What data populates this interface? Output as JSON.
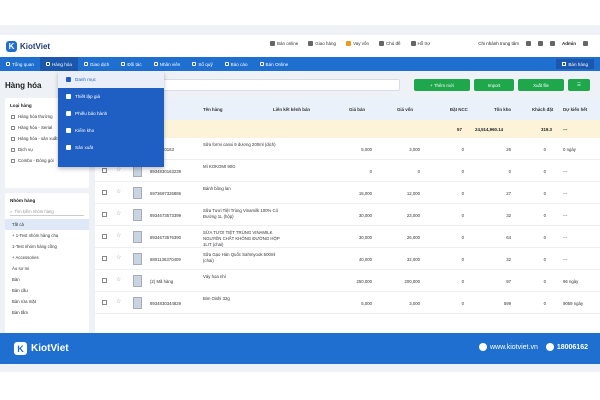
{
  "brand": {
    "name": "KiotViet",
    "letter": "K"
  },
  "toplinks": [
    "Bán online",
    "Giao hàng",
    "Vay vốn",
    "Chủ đề",
    "Hỗ trợ"
  ],
  "topright": {
    "branch": "Chi nhánh trung tâm",
    "user": "Admin"
  },
  "nav": {
    "items": [
      "Tổng quan",
      "Hàng hóa",
      "Giao dịch",
      "Đối tác",
      "Nhân viên",
      "Sổ quỹ",
      "Báo cáo",
      "Bán Online"
    ],
    "right": "Bán hàng"
  },
  "dropdown": [
    "Danh mục",
    "Thiết lập giá",
    "Phiếu bảo hành",
    "Kiểm kho",
    "Sản xuất"
  ],
  "page": {
    "title": "Hàng hóa",
    "btn_add": "+ Thêm mới",
    "btn_import": "Import",
    "btn_export": "Xuất file"
  },
  "left_type": {
    "title": "Loại hàng",
    "items": [
      "Hàng hóa thường",
      "Hàng hóa - Serial",
      "Hàng hóa - sản xuất",
      "Dịch vụ",
      "Combo - Đóng gói"
    ]
  },
  "left_group": {
    "title": "Nhóm hàng",
    "search_placeholder": "Tìm kiếm nhóm hàng",
    "items": [
      "Tất cả",
      "+ 1-Test nhóm hàng cha",
      "1-Test nhóm hàng cồng",
      "+ Accessories",
      "Áo sơ mi",
      "Bàn",
      "Bàn cầu",
      "Bàn rửa mặt",
      "Bàn tắm"
    ]
  },
  "table": {
    "headers": [
      "Mã hàng",
      "Tên hàng",
      "Liên kết kênh bán",
      "Giá bán",
      "Giá vốn",
      "Đặt NCC",
      "Tồn kho",
      "Khách đặt",
      "Dự kiến hết"
    ],
    "summary": {
      "dat_ncc": "57",
      "ton_kho": "24,514,960.14",
      "khach_dat": "319.3",
      "du_kien": "---"
    },
    "rows": [
      {
        "code": "8934830163",
        "name": "Sữa formi canxi 9 dương 200ml (dịch)",
        "price": "5,000",
        "cost": "3,000",
        "ncc": "0",
        "stock": "26",
        "order": "0",
        "eta": "0 ngày"
      },
      {
        "code": "8934830163239",
        "name": "Mì KOKOMI 90G",
        "price": "0",
        "cost": "0",
        "ncc": "0",
        "stock": "0",
        "order": "0",
        "eta": "---"
      },
      {
        "code": "6973697326886",
        "name": "Bánh bông lan",
        "price": "15,000",
        "cost": "12,000",
        "ncc": "0",
        "stock": "27",
        "order": "0",
        "eta": "---"
      },
      {
        "code": "8934673573399",
        "name": "Sữa Tươi Tiệt Trùng Vinamilk 100% Có Đường 1L (hộp)",
        "price": "30,000",
        "cost": "23,000",
        "ncc": "0",
        "stock": "32",
        "order": "0",
        "eta": "---"
      },
      {
        "code": "8934673576390",
        "name": "SỮA TƯƠI TIỆT TRÙNG VINAMILK NGUYÊN CHẤT KHÔNG ĐƯỜNG HỘP 1LIT (chai)",
        "price": "30,000",
        "cost": "26,000",
        "ncc": "0",
        "stock": "64",
        "order": "0",
        "eta": "---"
      },
      {
        "code": "8801136370409",
        "name": "Sữa Gạo Hàn Quốc Sahmyook 500ml (chai)",
        "price": "40,000",
        "cost": "32,000",
        "ncc": "0",
        "stock": "32",
        "order": "0",
        "eta": "---"
      },
      {
        "code": "(2) Mã hàng",
        "name": "Váy hoa nhí",
        "price": "250,000",
        "cost": "200,000",
        "ncc": "0",
        "stock": "97",
        "order": "0",
        "eta": "96 ngày"
      },
      {
        "code": "8934830344829",
        "name": "Bim Oishi 32g",
        "price": "5,000",
        "cost": "3,000",
        "ncc": "0",
        "stock": "599",
        "order": "0",
        "eta": "9059 ngày"
      }
    ]
  },
  "footer": {
    "site": "www.kiotviet.vn",
    "phone": "18006162"
  }
}
